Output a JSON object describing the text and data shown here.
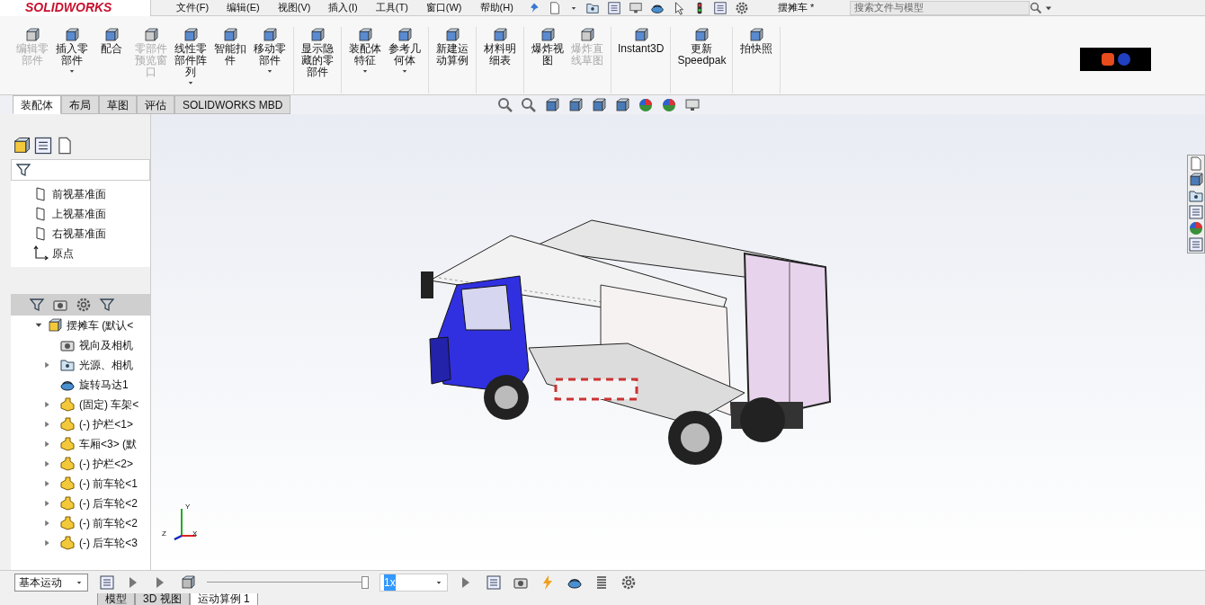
{
  "app": {
    "logo": "SOLIDWORKS",
    "document_title": "摆摊车 *"
  },
  "menu": [
    "文件(F)",
    "编辑(E)",
    "视图(V)",
    "插入(I)",
    "工具(T)",
    "窗口(W)",
    "帮助(H)"
  ],
  "search": {
    "placeholder": "搜索文件与模型"
  },
  "ribbon_groups": [
    [
      {
        "label": "编辑零部件",
        "disabled": true,
        "dropdown": false
      },
      {
        "label": "插入零部件",
        "disabled": false,
        "dropdown": true
      },
      {
        "label": "配合",
        "disabled": false,
        "dropdown": false
      },
      {
        "label": "零部件预览窗口",
        "disabled": true,
        "dropdown": false
      },
      {
        "label": "线性零部件阵列",
        "disabled": false,
        "dropdown": true
      },
      {
        "label": "智能扣件",
        "disabled": false,
        "dropdown": false
      },
      {
        "label": "移动零部件",
        "disabled": false,
        "dropdown": true
      }
    ],
    [
      {
        "label": "显示隐藏的零部件",
        "disabled": false,
        "dropdown": false
      }
    ],
    [
      {
        "label": "装配体特征",
        "disabled": false,
        "dropdown": true
      },
      {
        "label": "参考几何体",
        "disabled": false,
        "dropdown": true
      }
    ],
    [
      {
        "label": "新建运动算例",
        "disabled": false,
        "dropdown": false
      }
    ],
    [
      {
        "label": "材料明细表",
        "disabled": false,
        "dropdown": false
      }
    ],
    [
      {
        "label": "爆炸视图",
        "disabled": false,
        "dropdown": false
      },
      {
        "label": "爆炸直线草图",
        "disabled": true,
        "dropdown": false
      }
    ],
    [
      {
        "label": "Instant3D",
        "disabled": false,
        "dropdown": false
      }
    ],
    [
      {
        "label": "更新Speedpak",
        "disabled": false,
        "dropdown": false
      }
    ],
    [
      {
        "label": "拍快照",
        "disabled": false,
        "dropdown": false
      }
    ]
  ],
  "tabs": [
    {
      "label": "装配体",
      "selected": true
    },
    {
      "label": "布局",
      "selected": false
    },
    {
      "label": "草图",
      "selected": false
    },
    {
      "label": "评估",
      "selected": false
    },
    {
      "label": "SOLIDWORKS MBD",
      "selected": false
    }
  ],
  "reference_list": [
    {
      "label": "前视基准面",
      "kind": "plane"
    },
    {
      "label": "上视基准面",
      "kind": "plane"
    },
    {
      "label": "右视基准面",
      "kind": "plane"
    },
    {
      "label": "原点",
      "kind": "origin"
    }
  ],
  "tree": {
    "label": "摆摊车 (默认<",
    "expanded": true,
    "children": [
      {
        "label": "视向及相机",
        "kind": "camera",
        "expandable": false
      },
      {
        "label": "光源、相机",
        "kind": "folder",
        "expandable": true
      },
      {
        "label": "旋转马达1",
        "kind": "motor",
        "expandable": false
      },
      {
        "label": "(固定) 车架<",
        "kind": "part",
        "expandable": true
      },
      {
        "label": "(-) 护栏<1>",
        "kind": "part",
        "expandable": true
      },
      {
        "label": "车厢<3> (默",
        "kind": "part",
        "expandable": true
      },
      {
        "label": "(-) 护栏<2>",
        "kind": "part",
        "expandable": true
      },
      {
        "label": "(-) 前车轮<1",
        "kind": "part",
        "expandable": true
      },
      {
        "label": "(-) 后车轮<2",
        "kind": "part",
        "expandable": true
      },
      {
        "label": "(-) 前车轮<2",
        "kind": "part",
        "expandable": true
      },
      {
        "label": "(-) 后车轮<3",
        "kind": "part",
        "expandable": true
      }
    ]
  },
  "triad": [
    "Y",
    "X",
    "Z"
  ],
  "motion": {
    "study_type": "基本运动",
    "level": 1,
    "speed": "1x"
  },
  "bottom_tabs": [
    {
      "label": "模型",
      "selected": false
    },
    {
      "label": "3D 视图",
      "selected": false
    },
    {
      "label": "运动算例 1",
      "selected": true
    }
  ]
}
